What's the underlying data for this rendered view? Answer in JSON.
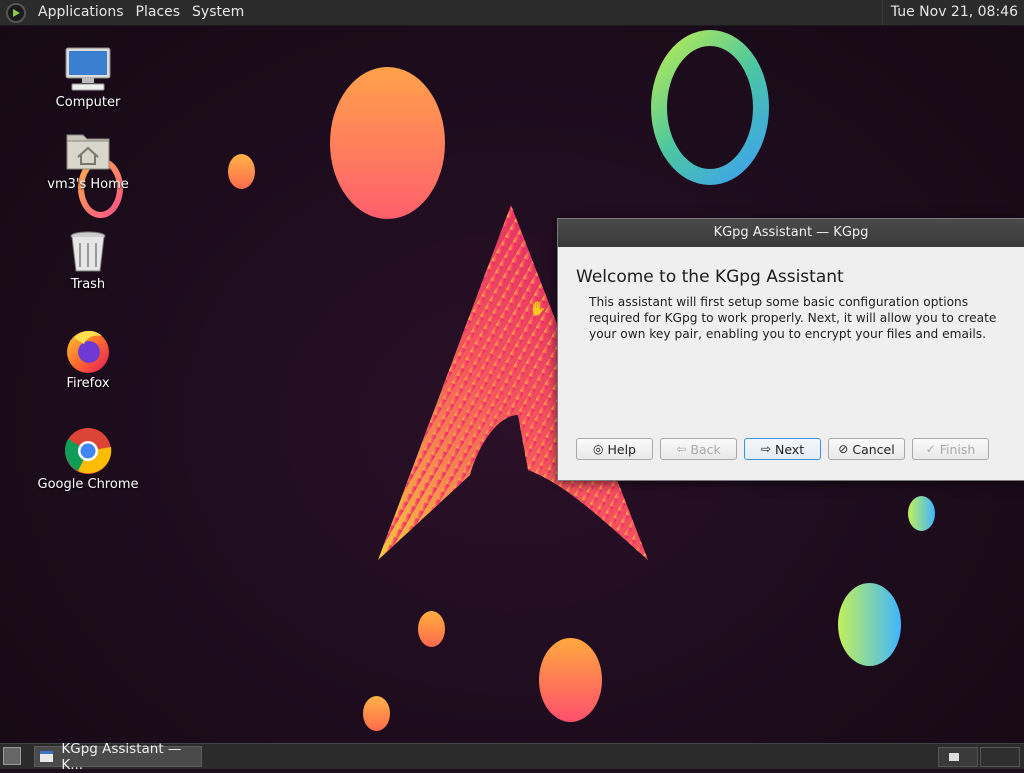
{
  "top_panel": {
    "menus": [
      "Applications",
      "Places",
      "System"
    ],
    "clock": "Tue Nov 21, 08:46"
  },
  "desktop_icons": [
    {
      "label": "Computer",
      "icon": "computer-icon"
    },
    {
      "label": "vm3's Home",
      "icon": "home-folder-icon"
    },
    {
      "label": "Trash",
      "icon": "trash-icon"
    },
    {
      "label": "Firefox",
      "icon": "firefox-icon"
    },
    {
      "label": "Google Chrome",
      "icon": "chrome-icon"
    }
  ],
  "dialog": {
    "title": "KGpg Assistant — KGpg",
    "heading": "Welcome to the KGpg Assistant",
    "body": "This assistant will first setup some basic configuration options required for KGpg to work properly. Next, it will allow you to create your own key pair, enabling you to encrypt your files and emails.",
    "buttons": {
      "help": "Help",
      "back": "Back",
      "next": "Next",
      "cancel": "Cancel",
      "finish": "Finish"
    }
  },
  "taskbar": {
    "task_label": "KGpg Assistant — K..."
  }
}
